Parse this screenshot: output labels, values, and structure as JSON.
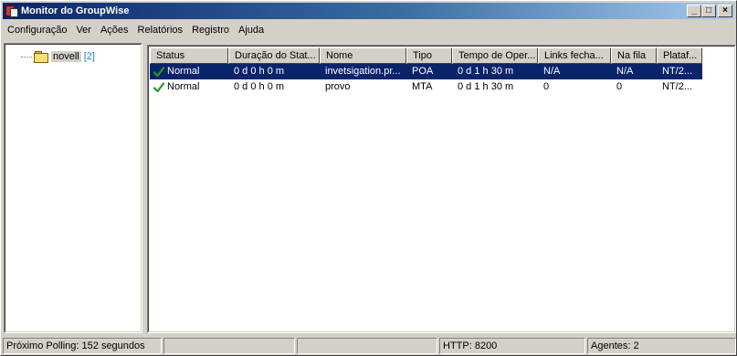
{
  "window": {
    "title": "Monitor do GroupWise",
    "minimize_glyph": "_",
    "maximize_glyph": "□",
    "close_glyph": "×"
  },
  "menu": [
    {
      "label": "Configuração"
    },
    {
      "label": "Ver"
    },
    {
      "label": "Ações"
    },
    {
      "label": "Relatórios"
    },
    {
      "label": "Registro"
    },
    {
      "label": "Ajuda"
    }
  ],
  "tree": {
    "node_label": "novell",
    "node_count": "[2]",
    "node_icon": "folder-icon"
  },
  "table": {
    "columns": [
      "Status",
      "Duração do Stat...",
      "Nome",
      "Tipo",
      "Tempo de Oper...",
      "Links fecha...",
      "Na fila",
      "Plataf..."
    ],
    "rows": [
      {
        "status": "Normal",
        "duracao": "0 d 0 h 0 m",
        "nome": "invetsigation.pr...",
        "tipo": "POA",
        "tempo": "0 d 1 h 30 m",
        "links": "N/A",
        "fila": "N/A",
        "plataforma": "NT/2...",
        "selected": true
      },
      {
        "status": "Normal",
        "duracao": "0 d 0 h 0 m",
        "nome": "provo",
        "tipo": "MTA",
        "tempo": "0 d 1 h 30 m",
        "links": "0",
        "fila": "0",
        "plataforma": "NT/2...",
        "selected": false
      }
    ]
  },
  "statusbar": {
    "polling": "Próximo Polling: 152 segundos",
    "empty1": "",
    "empty2": "",
    "http": "HTTP:  8200",
    "agents": "Agentes: 2"
  },
  "colors": {
    "selection": "#0a246a",
    "check": "#1f9a2a",
    "count": "#2080c0"
  }
}
